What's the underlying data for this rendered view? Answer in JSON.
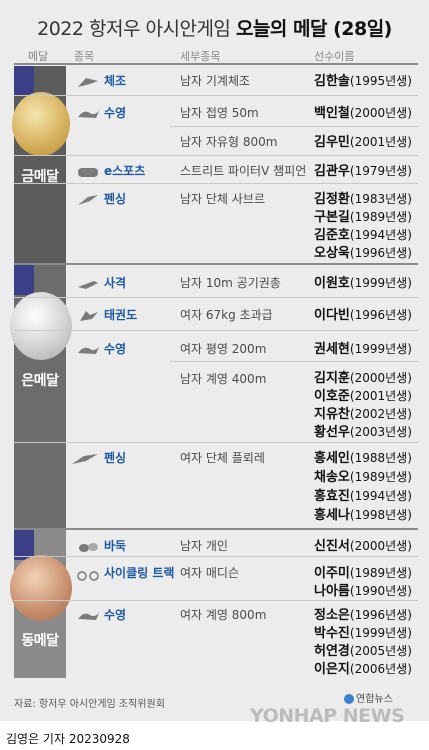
{
  "title": {
    "prefix": "2022 항저우 아시안게임 ",
    "bold": "오늘의 메달 (28일)"
  },
  "headers": {
    "medal": "메달",
    "sport": "종목",
    "event": "세부종목",
    "athlete": "선수이름"
  },
  "medals": [
    {
      "label": "금메달"
    },
    {
      "label": "은메달"
    },
    {
      "label": "동메달"
    }
  ],
  "gold": {
    "rows": [
      {
        "sport": "체조",
        "event": "남자 기계체조",
        "athletes": [
          {
            "name": "김한솔",
            "year": "(1995년생)"
          }
        ]
      },
      {
        "sport": "수영",
        "event": "남자 접영 50m",
        "athletes": [
          {
            "name": "백인철",
            "year": "(2000년생)"
          }
        ]
      },
      {
        "sport": "",
        "event": "남자 자유형 800m",
        "athletes": [
          {
            "name": "김우민",
            "year": "(2001년생)"
          }
        ]
      },
      {
        "sport": "e스포츠",
        "event": "스트리트 파이터V 챔피언",
        "athletes": [
          {
            "name": "김관우",
            "year": "(1979년생)"
          }
        ]
      },
      {
        "sport": "펜싱",
        "event": "남자 단체 사브르",
        "athletes": [
          {
            "name": "김정환",
            "year": "(1983년생)"
          },
          {
            "name": "구본길",
            "year": "(1989년생)"
          },
          {
            "name": "김준호",
            "year": "(1994년생)"
          },
          {
            "name": "오상욱",
            "year": "(1996년생)"
          }
        ]
      }
    ]
  },
  "silver": {
    "rows": [
      {
        "sport": "사격",
        "event": "남자 10m 공기권총",
        "athletes": [
          {
            "name": "이원호",
            "year": "(1999년생)"
          }
        ]
      },
      {
        "sport": "태권도",
        "event": "여자 67kg 초과급",
        "athletes": [
          {
            "name": "이다빈",
            "year": "(1996년생)"
          }
        ]
      },
      {
        "sport": "수영",
        "event": "여자 평영 200m",
        "athletes": [
          {
            "name": "권세현",
            "year": "(1999년생)"
          }
        ]
      },
      {
        "sport": "",
        "event": "남자 계영 400m",
        "athletes": [
          {
            "name": "김지훈",
            "year": "(2000년생)"
          },
          {
            "name": "이호준",
            "year": "(2001년생)"
          },
          {
            "name": "지유찬",
            "year": "(2002년생)"
          },
          {
            "name": "황선우",
            "year": "(2003년생)"
          }
        ]
      },
      {
        "sport": "펜싱",
        "event": "여자 단체 플뢰레",
        "athletes": [
          {
            "name": "홍세인",
            "year": "(1988년생)"
          },
          {
            "name": "채송오",
            "year": "(1989년생)"
          },
          {
            "name": "홍효진",
            "year": "(1994년생)"
          },
          {
            "name": "홍세나",
            "year": "(1998년생)"
          }
        ]
      }
    ]
  },
  "bronze": {
    "rows": [
      {
        "sport": "바둑",
        "event": "남자 개인",
        "athletes": [
          {
            "name": "신진서",
            "year": "(2000년생)"
          }
        ]
      },
      {
        "sport": "사이클링 트랙",
        "event": "여자 매디슨",
        "athletes": [
          {
            "name": "이주미",
            "year": "(1989년생)"
          },
          {
            "name": "나아름",
            "year": "(1990년생)"
          }
        ]
      },
      {
        "sport": "수영",
        "event": "여자 계영 800m",
        "athletes": [
          {
            "name": "정소은",
            "year": "(1996년생)"
          },
          {
            "name": "박수진",
            "year": "(1999년생)"
          },
          {
            "name": "허연경",
            "year": "(2005년생)"
          },
          {
            "name": "이은지",
            "year": "(2006년생)"
          }
        ]
      }
    ]
  },
  "source": "자료: 항저우 아시안게임 조직위원회",
  "logo": "연합뉴스",
  "watermark": "YONHAP NEWS",
  "footer": "김영은 기자  20230928",
  "colors": {
    "sport": "#1e5aa0",
    "ribbon": "#3a3f86",
    "gold": "#d6b25e",
    "silver": "#d2d2d2",
    "bronze": "#c99270"
  }
}
